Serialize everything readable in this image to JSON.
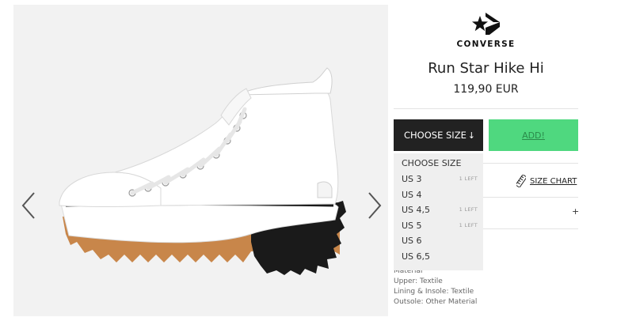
{
  "gallery": {
    "prev_icon": "chevron-left-icon",
    "next_icon": "chevron-right-icon",
    "colors": {
      "background": "#f2f2f2",
      "shoe_canvas": "#ffffff",
      "gum_sole": "#c8864a",
      "lug_sole": "#1a1a1a"
    }
  },
  "product": {
    "brand": "CONVERSE",
    "brand_icon": "converse-star-chevron-logo",
    "name": "Run Star Hike Hi",
    "price": "119,90 EUR"
  },
  "actions": {
    "choose_size_label": "CHOOSE SIZE",
    "choose_size_arrow": "↓",
    "add_label": "ADD!",
    "colors": {
      "choose_bg": "#222222",
      "add_bg": "#4fd87f"
    }
  },
  "size_dropdown": {
    "header": "CHOOSE SIZE",
    "options": [
      {
        "label": "US 3",
        "stock": "1 LEFT"
      },
      {
        "label": "US 4",
        "stock": ""
      },
      {
        "label": "US 4,5",
        "stock": "1 LEFT"
      },
      {
        "label": "US 5",
        "stock": "1 LEFT"
      },
      {
        "label": "US 6",
        "stock": ""
      },
      {
        "label": "US 6,5",
        "stock": ""
      }
    ]
  },
  "size_chart": {
    "icon": "ruler-icon",
    "label": "SIZE CHART"
  },
  "details": {
    "expand_icon": "+"
  },
  "material": {
    "heading": "Material",
    "lines": [
      "Upper: Textile",
      "Lining & Insole: Textile",
      "Outsole: Other Material"
    ]
  }
}
